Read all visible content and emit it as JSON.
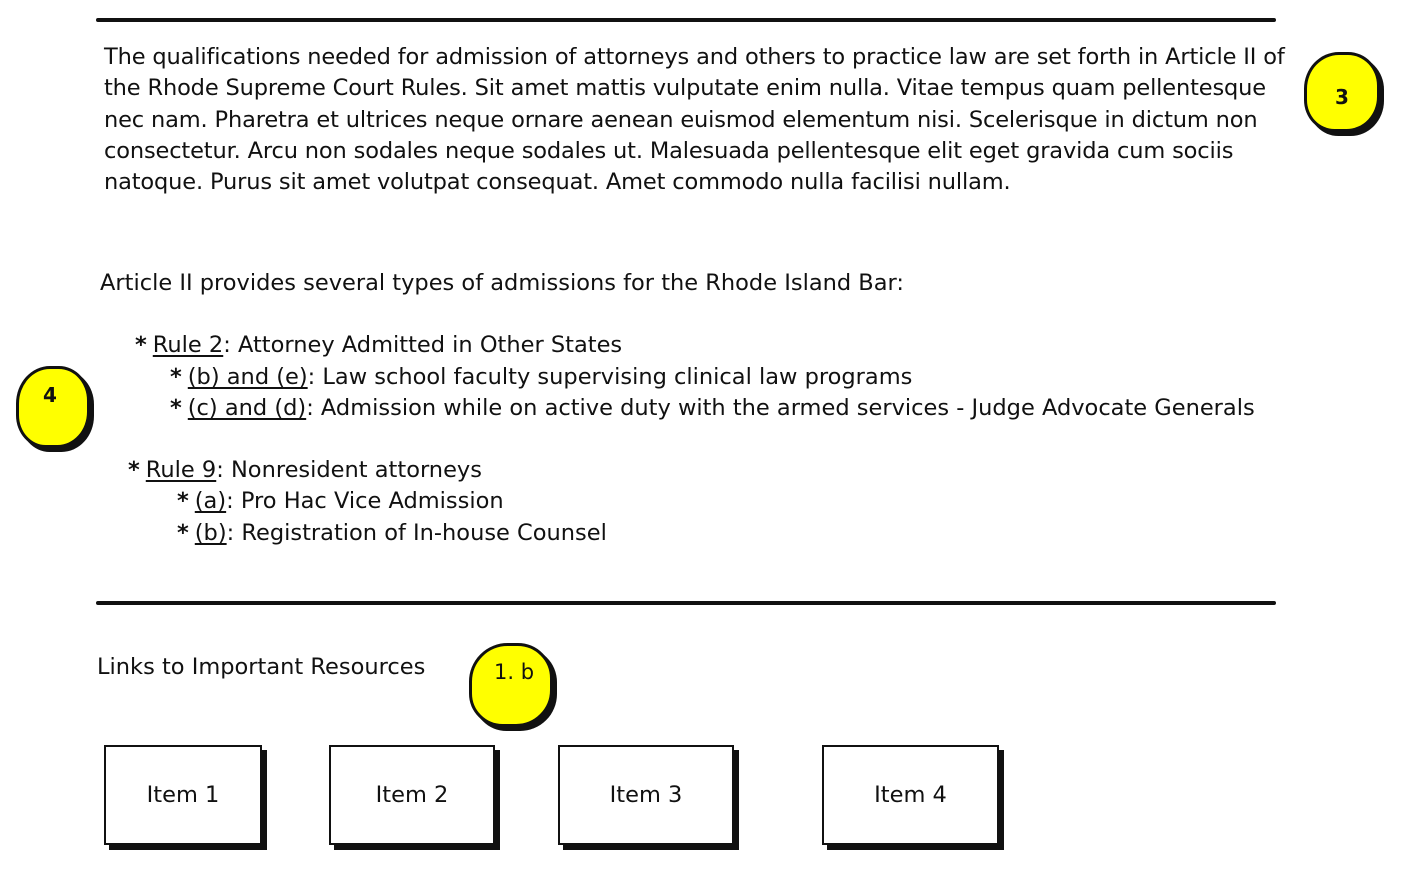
{
  "intro": {
    "paragraph": "The qualifications needed for admission of attorneys and others to practice law are set forth in Article II of the Rhode Supreme Court Rules. Sit amet mattis vulputate enim nulla. Vitae tempus quam pellentesque nec nam. Pharetra et ultrices neque ornare aenean euismod elementum nisi. Scelerisque in dictum non consectetur. Arcu non sodales neque sodales ut. Malesuada pellentesque elit eget gravida cum sociis natoque. Purus sit amet volutpat consequat. Amet commodo nulla facilisi nullam."
  },
  "types": {
    "heading": "Article II provides several types of admissions for the Rhode Island Bar:",
    "bullet": "*",
    "rule2": {
      "link": "Rule 2",
      "text": ": Attorney Admitted in Other States",
      "sub": [
        {
          "link": "(b) and (e)",
          "text": ": Law school faculty supervising clinical law programs"
        },
        {
          "link": "(c) and (d)",
          "text": ": Admission while on active duty with the armed services - Judge Advocate Generals"
        }
      ]
    },
    "rule9": {
      "link": "Rule 9",
      "text": ": Nonresident attorneys",
      "sub": [
        {
          "link": "(a)",
          "text": ": Pro Hac Vice Admission"
        },
        {
          "link": "(b)",
          "text": ": Registration of In-house Counsel"
        }
      ]
    }
  },
  "links": {
    "title": "Links to Important Resources",
    "items": [
      "Item 1",
      "Item 2",
      "Item 3",
      "Item 4"
    ]
  },
  "markers": {
    "m3": "3",
    "m4": "4",
    "m1b": "1. b"
  },
  "colors": {
    "marker": "#ffff00",
    "ink": "#111111",
    "background": "#ffffff"
  }
}
